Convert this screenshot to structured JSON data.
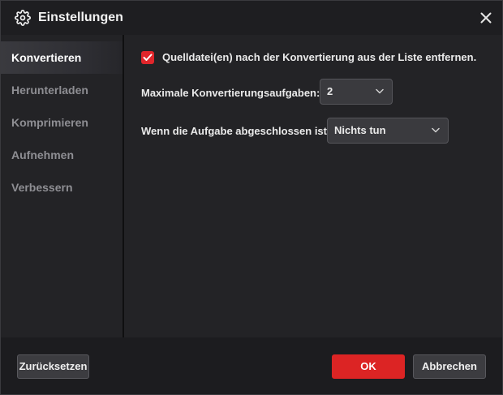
{
  "window": {
    "title": "Einstellungen",
    "title_icon": "gear-icon",
    "close_icon": "close-icon"
  },
  "sidebar": {
    "items": [
      {
        "label": "Konvertieren",
        "active": true
      },
      {
        "label": "Herunterladen",
        "active": false
      },
      {
        "label": "Komprimieren",
        "active": false
      },
      {
        "label": "Aufnehmen",
        "active": false
      },
      {
        "label": "Verbessern",
        "active": false
      }
    ]
  },
  "content": {
    "remove_source": {
      "checked": true,
      "label": "Quelldatei(en) nach der Konvertierung aus der Liste entfernen."
    },
    "max_tasks": {
      "label": "Maximale Konvertierungsaufgaben:",
      "value": "2"
    },
    "on_complete": {
      "label": "Wenn die Aufgabe abgeschlossen ist:",
      "value": "Nichts tun"
    }
  },
  "footer": {
    "reset_label": "Zurücksetzen",
    "ok_label": "OK",
    "cancel_label": "Abbrechen"
  },
  "colors": {
    "accent": "#dc2424",
    "background": "#232326",
    "footer": "#1c1c1f"
  }
}
